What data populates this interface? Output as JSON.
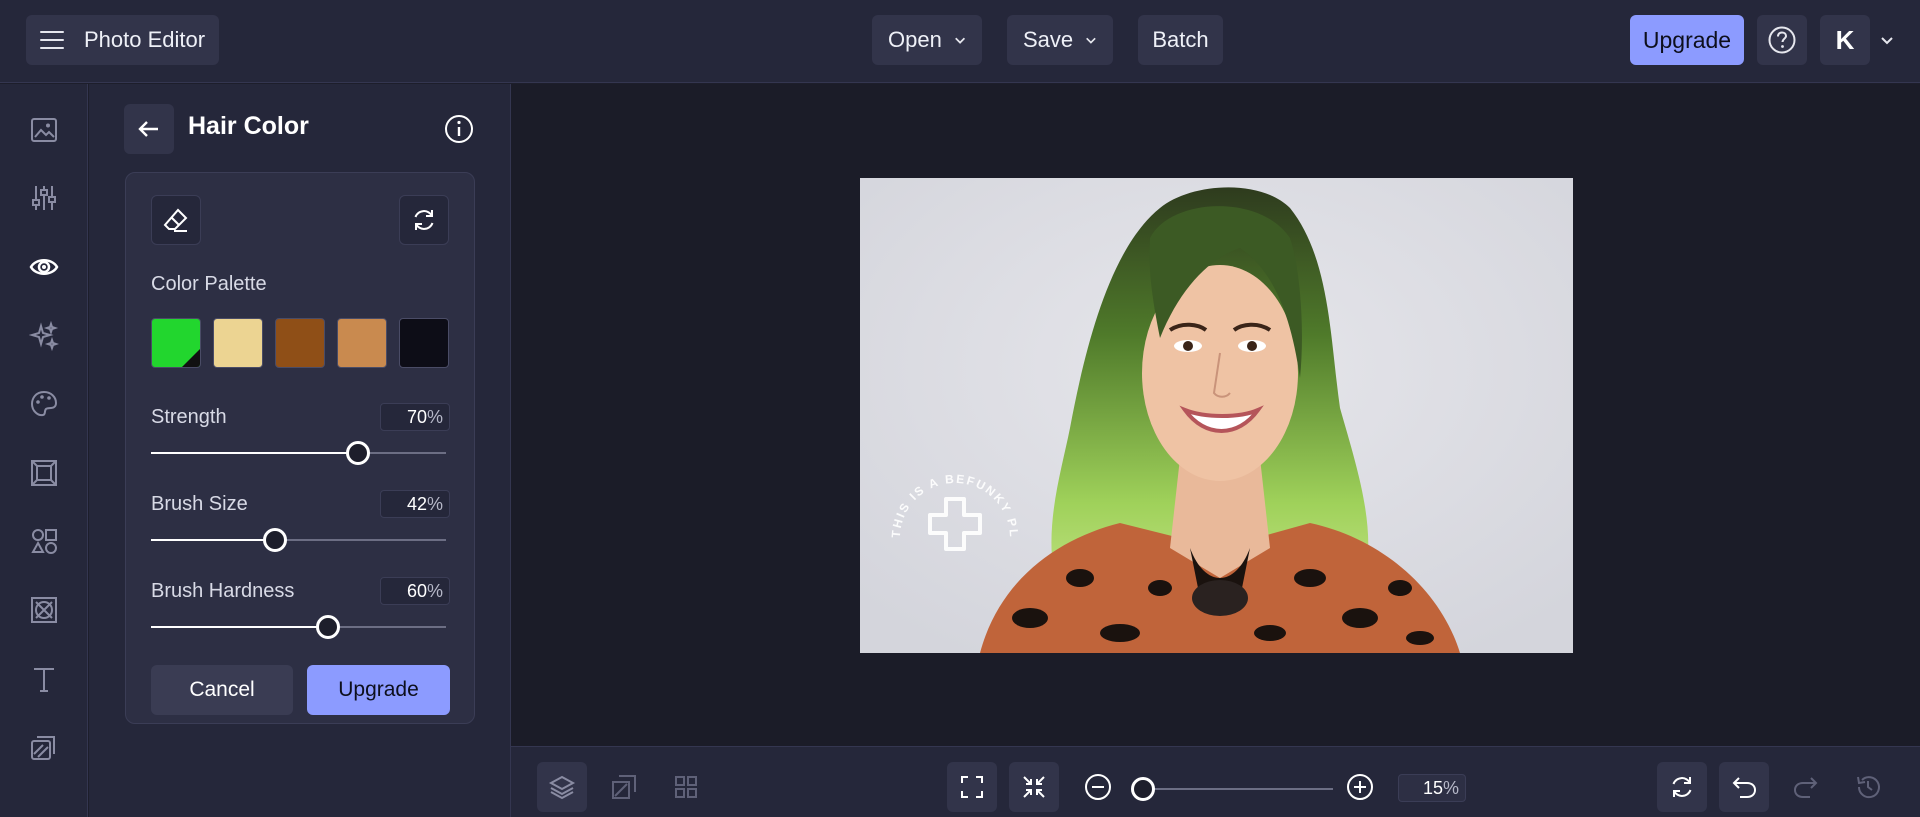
{
  "header": {
    "app_title": "Photo Editor",
    "menus": [
      {
        "label": "Open"
      },
      {
        "label": "Save"
      },
      {
        "label": "Batch"
      }
    ],
    "upgrade_label": "Upgrade",
    "avatar_initial": "K"
  },
  "sidebar": {
    "tools": [
      "image-icon",
      "sliders-icon",
      "eye-icon",
      "sparkles-icon",
      "palette-icon",
      "frame-icon",
      "shapes-icon",
      "overlay-icon",
      "text-icon",
      "layers-stack-icon"
    ],
    "active_tool": "eye-icon"
  },
  "panel": {
    "title": "Hair Color",
    "palette_label": "Color Palette",
    "swatches": [
      "#22d62e",
      "#ecd492",
      "#8f4f17",
      "#c98a4f",
      "#0d0d17"
    ],
    "strength": {
      "label": "Strength",
      "value": "70",
      "unit": "%",
      "fraction": 0.7
    },
    "brush_size": {
      "label": "Brush Size",
      "value": "42",
      "unit": "%",
      "fraction": 0.42
    },
    "brush_hardness": {
      "label": "Brush Hardness",
      "value": "60",
      "unit": "%",
      "fraction": 0.6
    },
    "cancel_label": "Cancel",
    "upgrade_label": "Upgrade"
  },
  "watermark": {
    "text": "THIS IS A BEFUNKY PLUS FEATURE"
  },
  "bottom": {
    "zoom_value": "15",
    "zoom_unit": "%",
    "zoom_fraction": 0.05
  },
  "colors": {
    "accent": "#8c9bff",
    "background": "#1d1e2b",
    "panel": "#25273a"
  }
}
